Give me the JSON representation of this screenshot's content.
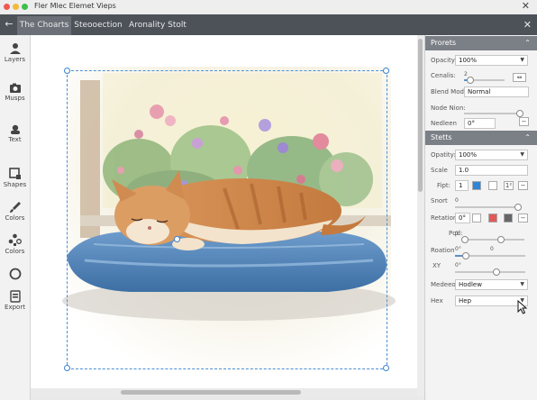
{
  "window": {
    "title": "Fler Mlec   Elemet Vieps"
  },
  "tabs": [
    {
      "label": "The Choarts"
    },
    {
      "label": "Steooection"
    },
    {
      "label": "Aronality Stolt"
    }
  ],
  "tools": [
    {
      "label": "Layers",
      "icon": "layers-icon"
    },
    {
      "label": "Musps",
      "icon": "image-icon"
    },
    {
      "label": "Text",
      "icon": "text-icon"
    },
    {
      "label": "Shapes",
      "icon": "shapes-icon"
    },
    {
      "label": "Colors",
      "icon": "brush-icon"
    },
    {
      "label": "Colors",
      "icon": "color-swap-icon"
    },
    {
      "label": "",
      "icon": "circle-icon"
    },
    {
      "label": "Export",
      "icon": "export-icon"
    }
  ],
  "panel": {
    "props": {
      "title": "Prorets",
      "opacity_label": "Opacity:",
      "opacity_value": "100%",
      "cenalis_label": "Cenalis:",
      "cenalis_tick": "2",
      "blend_label": "Blend Mode:",
      "blend_value": "Normal",
      "node_label": "Node Nion:",
      "nedleen_label": "Nedleen",
      "nedleen_value": "0°"
    },
    "stetts": {
      "title": "Stetts",
      "opacity_label": "Opatity:",
      "opacity_value": "100%",
      "scale_label": "Scale",
      "scale_value": "1.0",
      "fipt_label": "Fipt:",
      "fipt_value": "1",
      "fipt_btn": "1²",
      "snort_label": "Snort",
      "snort_tick": "0",
      "rotation_label": "Retation:",
      "rotation_value": "0°",
      "pqd_label": "Pqd:",
      "pqd_tick": "0",
      "roation_label": "Roation",
      "roation_tick_a": "0°",
      "roation_tick_b": "0",
      "xy_label": "XY",
      "xy_tick": "0°",
      "medee_label": "Medeeo:",
      "medee_value": "Hodlew",
      "hex_label": "Hex",
      "hex_value": "Hep"
    },
    "colors": {
      "blue": "#2f86d6",
      "red": "#e05a5a",
      "gray": "#666666"
    },
    "opacity_pct": 100,
    "pqd_fraction": 0.62
  }
}
